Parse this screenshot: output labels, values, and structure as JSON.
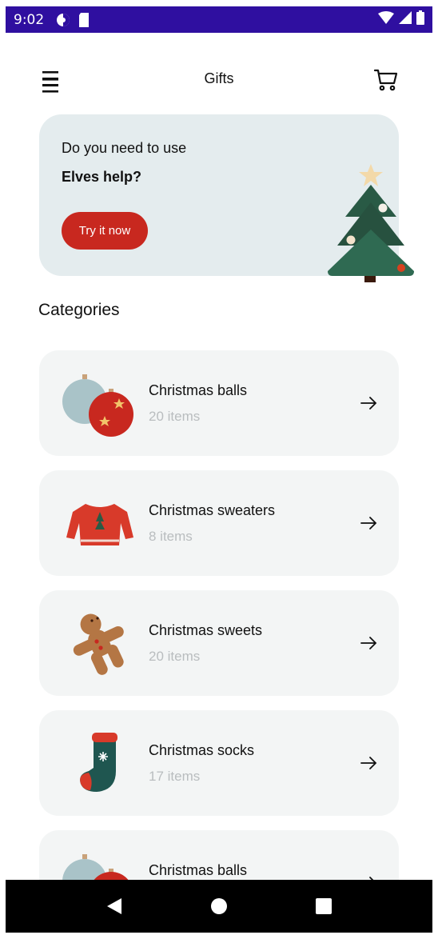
{
  "status_bar": {
    "time": "9:02",
    "icons": [
      "data-saver-icon",
      "sd-card-icon",
      "wifi-icon",
      "signal-icon",
      "battery-icon"
    ]
  },
  "app_bar": {
    "title": "Gifts",
    "menu_icon": "hamburger-menu-icon",
    "cart_icon": "shopping-cart-icon"
  },
  "banner": {
    "line1": "Do you need to use",
    "line2": "Elves help?",
    "button_label": "Try it now",
    "illustration": "christmas-tree-icon",
    "colors": {
      "background": "#e4ecee",
      "button": "#c8281f"
    }
  },
  "categories": {
    "title": "Categories",
    "items": [
      {
        "name": "Christmas balls",
        "count": "20 items",
        "icon": "christmas-balls-icon"
      },
      {
        "name": "Christmas sweaters",
        "count": "8 items",
        "icon": "sweater-icon"
      },
      {
        "name": "Christmas sweets",
        "count": "20 items",
        "icon": "gingerbread-icon"
      },
      {
        "name": "Christmas socks",
        "count": "17 items",
        "icon": "stocking-icon"
      },
      {
        "name": "Christmas balls",
        "count": "",
        "icon": "christmas-balls-icon"
      }
    ]
  },
  "nav_bar": {
    "buttons": [
      "back-icon",
      "home-icon",
      "recents-icon"
    ]
  },
  "colors": {
    "status_bar": "#2f0fa0",
    "accent_red": "#c8281f",
    "card_background": "#f3f5f5",
    "muted_text": "#b9bdbf"
  }
}
